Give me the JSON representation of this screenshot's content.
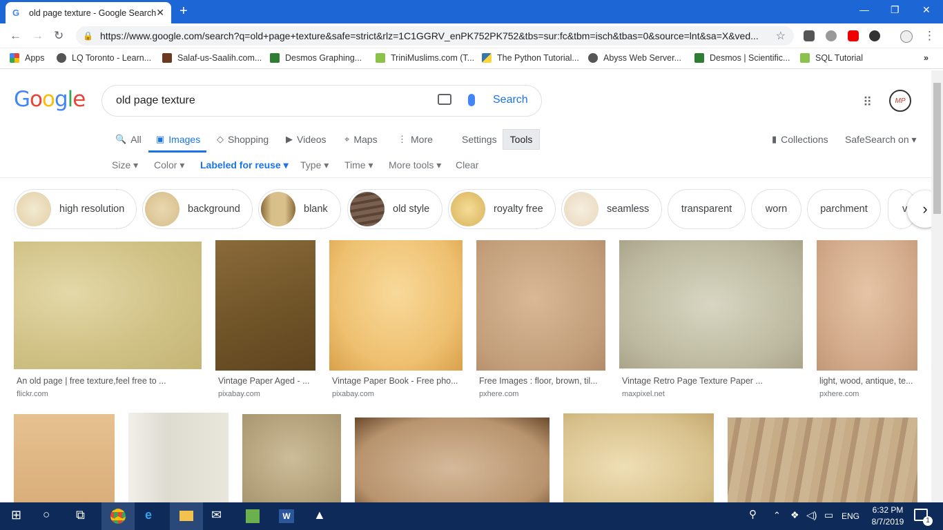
{
  "browser": {
    "tab_title": "old page texture - Google Search",
    "tab_icon": "G",
    "tab_close": "✕",
    "new_tab": "+",
    "url": "https://www.google.com/search?q=old+page+texture&safe=strict&rlz=1C1GGRV_enPK752PK752&tbs=sur:fc&tbm=isch&tbas=0&source=lnt&sa=X&ved...",
    "bookmarks": [
      "Apps",
      "LQ Toronto - Learn...",
      "Salaf-us-Saalih.com...",
      "Desmos Graphing...",
      "TriniMuslims.com (T...",
      "The Python Tutorial...",
      "Abyss Web Server...",
      "Desmos | Scientific...",
      "SQL Tutorial"
    ],
    "bookmarks_more": "»"
  },
  "search": {
    "query": "old page texture",
    "search_button": "Search",
    "logo": [
      "G",
      "o",
      "o",
      "g",
      "l",
      "e"
    ],
    "avatar_initials": "MP"
  },
  "nav": {
    "all": "All",
    "images": "Images",
    "shopping": "Shopping",
    "videos": "Videos",
    "maps": "Maps",
    "more": "More",
    "settings": "Settings",
    "tools": "Tools",
    "collections": "Collections",
    "safesearch": "SafeSearch on ▾"
  },
  "filters": {
    "size": "Size ▾",
    "color": "Color ▾",
    "labeled": "Labeled for reuse ▾",
    "type": "Type ▾",
    "time": "Time ▾",
    "more_tools": "More tools ▾",
    "clear": "Clear"
  },
  "chips": [
    "high resolution",
    "background",
    "blank",
    "old style",
    "royalty free",
    "seamless",
    "transparent",
    "worn",
    "parchment",
    "v"
  ],
  "results_row1": [
    {
      "caption": "An old page | free texture,feel free to ...",
      "source": "flickr.com"
    },
    {
      "caption": "Vintage Paper Aged - ...",
      "source": "pixabay.com"
    },
    {
      "caption": "Vintage Paper Book - Free pho...",
      "source": "pixabay.com"
    },
    {
      "caption": "Free Images : floor, brown, til...",
      "source": "pxhere.com"
    },
    {
      "caption": "Vintage Retro Page Texture Paper ...",
      "source": "maxpixel.net"
    },
    {
      "caption": "light, wood, antique, te...",
      "source": "pxhere.com"
    }
  ],
  "taskbar": {
    "time": "6:32 PM",
    "date": "8/7/2019",
    "lang": "ENG",
    "notif_count": "1"
  },
  "colors": {
    "tabbar": "#1d66d6",
    "taskbar": "#0d2a58",
    "link_blue": "#1a73e8"
  }
}
